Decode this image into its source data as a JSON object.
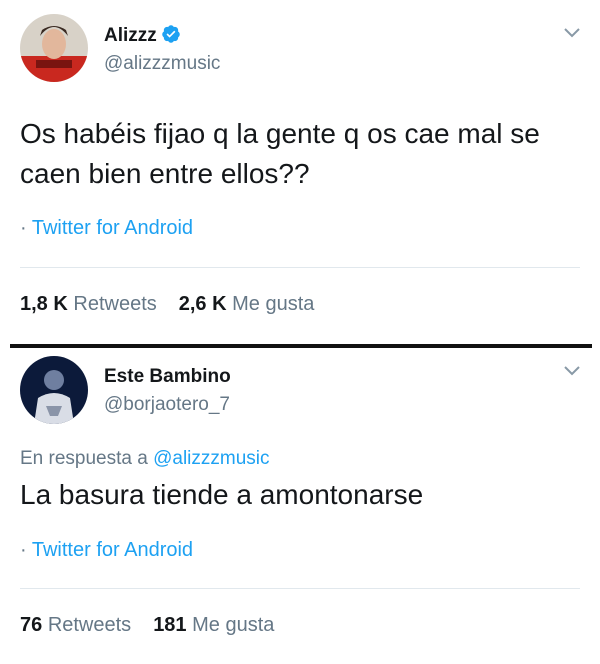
{
  "tweets": [
    {
      "name": "Alizzz",
      "verified": true,
      "handle": "@alizzzmusic",
      "text": "Os habéis fijao q la gente q os cae mal se caen bien entre ellos??",
      "source": "Twitter for Android",
      "retweets_count": "1,8 K",
      "retweets_label": "Retweets",
      "likes_count": "2,6 K",
      "likes_label": "Me gusta"
    },
    {
      "name": "Este Bambino",
      "verified": false,
      "handle": "@borjaotero_7",
      "reply_prefix": "En respuesta a",
      "reply_to": "@alizzzmusic",
      "text": "La basura tiende a amontonarse",
      "source": "Twitter for Android",
      "retweets_count": "76",
      "retweets_label": "Retweets",
      "likes_count": "181",
      "likes_label": "Me gusta"
    }
  ],
  "colors": {
    "accent": "#1da1f2",
    "secondary_text": "#657786",
    "divider": "#111111"
  },
  "icons": [
    "verified-badge-icon",
    "chevron-down-icon",
    "avatar"
  ]
}
